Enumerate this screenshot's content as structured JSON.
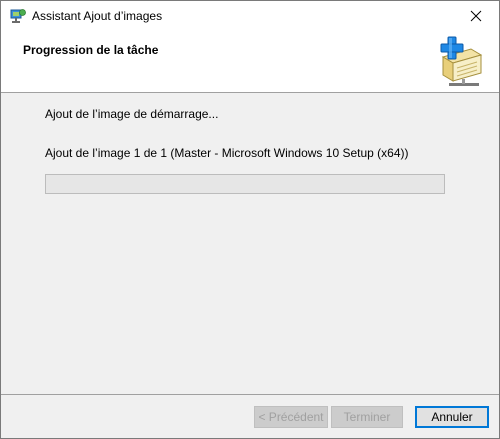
{
  "window": {
    "title": "Assistant Ajout d’images",
    "close_label": "×"
  },
  "header": {
    "heading": "Progression de la tâche",
    "icon": "add-image-wizard-icon"
  },
  "main": {
    "status_line_1": "Ajout de l’image de démarrage...",
    "status_line_2": "Ajout de l’image 1 de 1 (Master - Microsoft Windows 10 Setup (x64))",
    "progress_fraction": 0
  },
  "footer": {
    "previous_label": "< Précédent",
    "finish_label": "Terminer",
    "cancel_label": "Annuler"
  },
  "colors": {
    "accent": "#0078d7",
    "progress_fill": "#06b025",
    "header_bg": "#ffffff",
    "body_bg": "#f0f0f0"
  }
}
